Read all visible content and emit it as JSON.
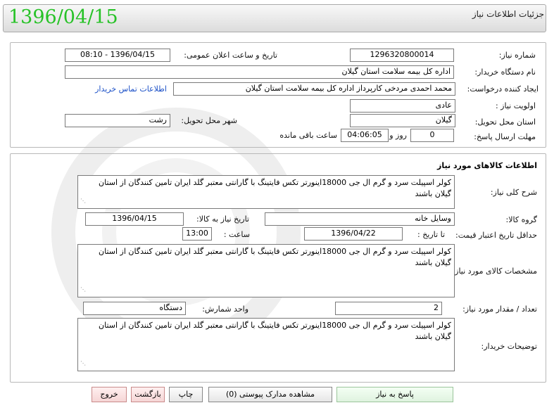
{
  "header": {
    "title": "جزئیات اطلاعات نیاز",
    "stamp_date": "1396/04/15"
  },
  "info": {
    "need_number_label": "شماره نیاز:",
    "need_number": "1296320800014",
    "announce_label": "تاریخ و ساعت اعلان عمومی:",
    "announce_value": "1396/04/15 - 08:10",
    "buyer_org_label": "نام دستگاه خریدار:",
    "buyer_org": "اداره کل بیمه سلامت استان گیلان",
    "requester_label": "ایجاد کننده درخواست:",
    "requester": "محمد احمدی مردخی کارپرداز اداره کل بیمه سلامت استان گیلان",
    "contact_link": "اطلاعات تماس خریدار",
    "priority_label": "اولویت نیاز :",
    "priority": "عادی",
    "province_label": "استان محل تحویل:",
    "province": "گیلان",
    "city_label": "شهر محل تحویل:",
    "city": "رشت",
    "deadline_label": "مهلت ارسال پاسخ:",
    "days_value": "0",
    "days_label": "روز و",
    "time_value": "04:06:05",
    "remaining_label": "ساعت باقی مانده"
  },
  "goods": {
    "section_title": "اطلاعات کالاهای مورد نیاز",
    "summary_label": "شرح کلی نیاز:",
    "summary": "کولر اسپیلت سرد و گرم ال جی 18000اینورتر تکس فایتینگ با گارانتی معتبر گلد ایران تامین کنندگان از استان گیلان باشند",
    "group_label": "گروه کالا:",
    "group": "وسایل خانه",
    "need_date_label": "تاریخ نیاز به کالا:",
    "need_date": "1396/04/15",
    "min_price_label": "حداقل تاریخ اعتبار قیمت:",
    "until_label": "تا تاریخ :",
    "until_date": "1396/04/22",
    "hour_label": "ساعت :",
    "hour": "13:00",
    "spec_label": "مشخصات کالای مورد نیاز:",
    "spec": "کولر اسپیلت سرد و گرم ال جی 18000اینورتر تکس فایتینگ با گارانتی معتبر گلد ایران تامین کنندگان از استان گیلان باشند",
    "qty_label": "تعداد / مقدار مورد نیاز:",
    "qty": "2",
    "unit_label": "واحد شمارش:",
    "unit": "دستگاه",
    "buyer_desc_label": "توضیحات خریدار:",
    "buyer_desc": "کولر اسپیلت سرد و گرم ال جی 18000اینورتر تکس فایتینگ با گارانتی معتبر گلد ایران تامین کنندگان از استان گیلان باشند"
  },
  "buttons": {
    "reply": "پاسخ به نیاز",
    "attachments": "مشاهده مدارک پیوستی (0)",
    "print": "چاپ",
    "back": "بازگشت",
    "exit": "خروج"
  }
}
